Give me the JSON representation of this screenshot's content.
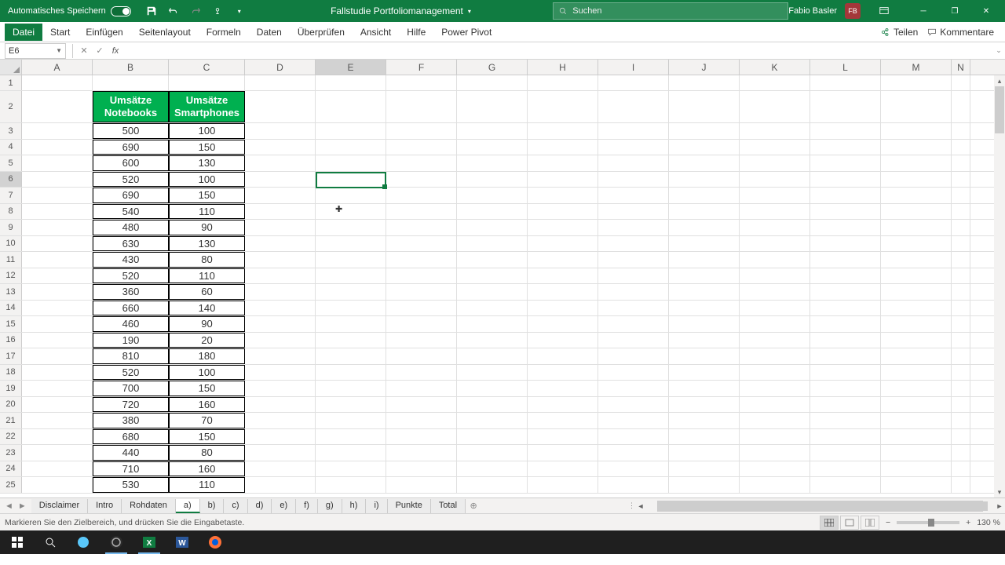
{
  "titlebar": {
    "autosave_label": "Automatisches Speichern",
    "doc_title": "Fallstudie Portfoliomanagement",
    "search_placeholder": "Suchen",
    "user_name": "Fabio Basler",
    "user_initials": "FB"
  },
  "ribbon": {
    "tabs": [
      "Datei",
      "Start",
      "Einfügen",
      "Seitenlayout",
      "Formeln",
      "Daten",
      "Überprüfen",
      "Ansicht",
      "Hilfe",
      "Power Pivot"
    ],
    "share": "Teilen",
    "comments": "Kommentare"
  },
  "namebox": {
    "ref": "E6"
  },
  "columns": [
    "A",
    "B",
    "C",
    "D",
    "E",
    "F",
    "G",
    "H",
    "I",
    "J",
    "K",
    "L",
    "M",
    "N"
  ],
  "selected_column": "E",
  "selected_row": "6",
  "table": {
    "header_b": "Umsätze Notebooks",
    "header_c": "Umsätze Smartphones",
    "rows": [
      {
        "b": "500",
        "c": "100"
      },
      {
        "b": "690",
        "c": "150"
      },
      {
        "b": "600",
        "c": "130"
      },
      {
        "b": "520",
        "c": "100"
      },
      {
        "b": "690",
        "c": "150"
      },
      {
        "b": "540",
        "c": "110"
      },
      {
        "b": "480",
        "c": "90"
      },
      {
        "b": "630",
        "c": "130"
      },
      {
        "b": "430",
        "c": "80"
      },
      {
        "b": "520",
        "c": "110"
      },
      {
        "b": "360",
        "c": "60"
      },
      {
        "b": "660",
        "c": "140"
      },
      {
        "b": "460",
        "c": "90"
      },
      {
        "b": "190",
        "c": "20"
      },
      {
        "b": "810",
        "c": "180"
      },
      {
        "b": "520",
        "c": "100"
      },
      {
        "b": "700",
        "c": "150"
      },
      {
        "b": "720",
        "c": "160"
      },
      {
        "b": "380",
        "c": "70"
      },
      {
        "b": "680",
        "c": "150"
      },
      {
        "b": "440",
        "c": "80"
      },
      {
        "b": "710",
        "c": "160"
      },
      {
        "b": "530",
        "c": "110"
      }
    ]
  },
  "sheets": [
    "Disclaimer",
    "Intro",
    "Rohdaten",
    "a)",
    "b)",
    "c)",
    "d)",
    "e)",
    "f)",
    "g)",
    "h)",
    "i)",
    "Punkte",
    "Total"
  ],
  "active_sheet": "a)",
  "statusbar": {
    "msg": "Markieren Sie den Zielbereich, und drücken Sie die Eingabetaste.",
    "zoom": "130 %"
  }
}
